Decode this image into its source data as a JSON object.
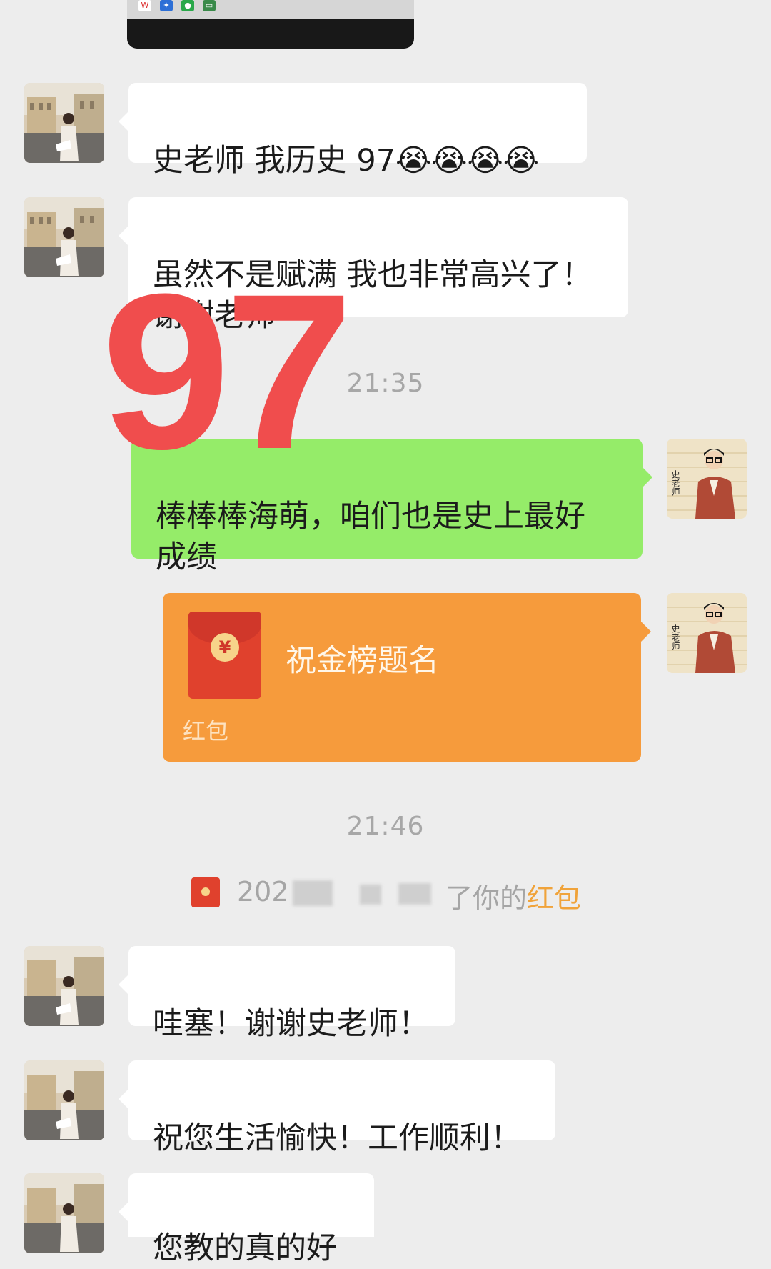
{
  "messages": {
    "m1": "史老师 我历史 97😭😭😭😭",
    "m2": "虽然不是赋满 我也非常高兴了！\n谢谢老师",
    "m3": "棒棒棒海萌，咱们也是史上最好\n成绩",
    "m4": "哇塞！谢谢史老师！",
    "m5": "祝您生活愉快！工作顺利！",
    "m6": "您教的真的好"
  },
  "times": {
    "t1": "21:35",
    "t2": "21:46"
  },
  "red_packet": {
    "title": "祝金榜题名",
    "label": "红包",
    "coin": "¥"
  },
  "notice": {
    "prefix": "202",
    "middle": "了你的",
    "link": "红包"
  },
  "overlay": {
    "text": "97",
    "color": "#f04d4d"
  },
  "teacher_avatar": {
    "chars": "史老师"
  },
  "colors": {
    "background": "#ededed",
    "green_bubble": "#95ec69",
    "red_packet": "#f69b3c"
  }
}
